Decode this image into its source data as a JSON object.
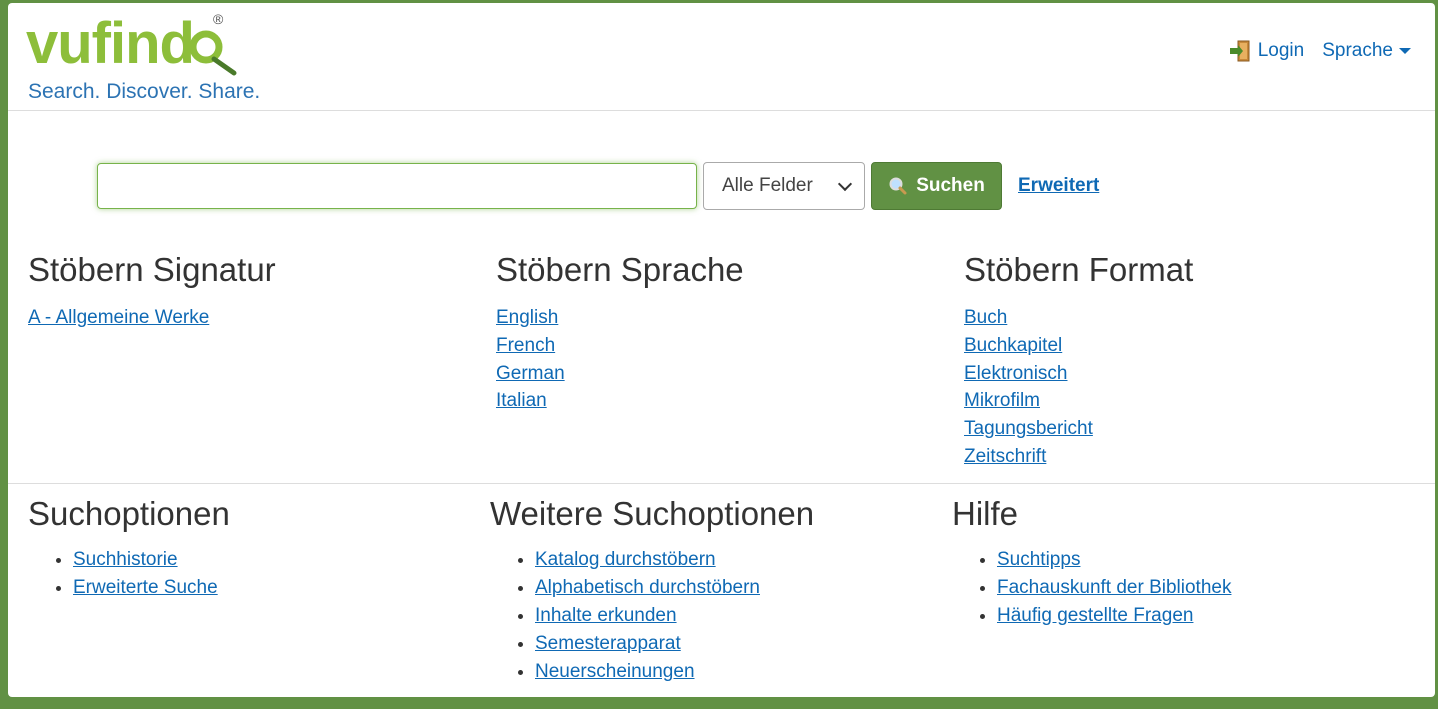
{
  "logo": {
    "word": "vufind",
    "reg": "®",
    "tagline": "Search. Discover. Share."
  },
  "topnav": {
    "login": "Login",
    "language": "Sprache"
  },
  "search": {
    "value": "",
    "placeholder": "",
    "type_selected": "Alle Felder",
    "button": "Suchen",
    "advanced": "Erweitert"
  },
  "browse": {
    "callnumber": {
      "title": "Stöbern Signatur",
      "items": [
        "A - Allgemeine Werke"
      ]
    },
    "language": {
      "title": "Stöbern Sprache",
      "items": [
        "English",
        "French",
        "German",
        "Italian"
      ]
    },
    "format": {
      "title": "Stöbern Format",
      "items": [
        "Buch",
        "Buchkapitel",
        "Elektronisch",
        "Mikrofilm",
        "Tagungsbericht",
        "Zeitschrift"
      ]
    }
  },
  "footer": {
    "search_options": {
      "title": "Suchoptionen",
      "items": [
        "Suchhistorie",
        "Erweiterte Suche"
      ]
    },
    "more_options": {
      "title": "Weitere Suchoptionen",
      "items": [
        "Katalog durchstöbern",
        "Alphabetisch durchstöbern",
        "Inhalte erkunden",
        "Semesterapparat",
        "Neuerscheinungen"
      ]
    },
    "help": {
      "title": "Hilfe",
      "items": [
        "Suchtipps",
        "Fachauskunft der Bibliothek",
        "Häufig gestellte Fragen"
      ]
    }
  },
  "colors": {
    "brand_green": "#619144",
    "logo_green": "#8dbe3a",
    "link_blue": "#0f69b4"
  }
}
